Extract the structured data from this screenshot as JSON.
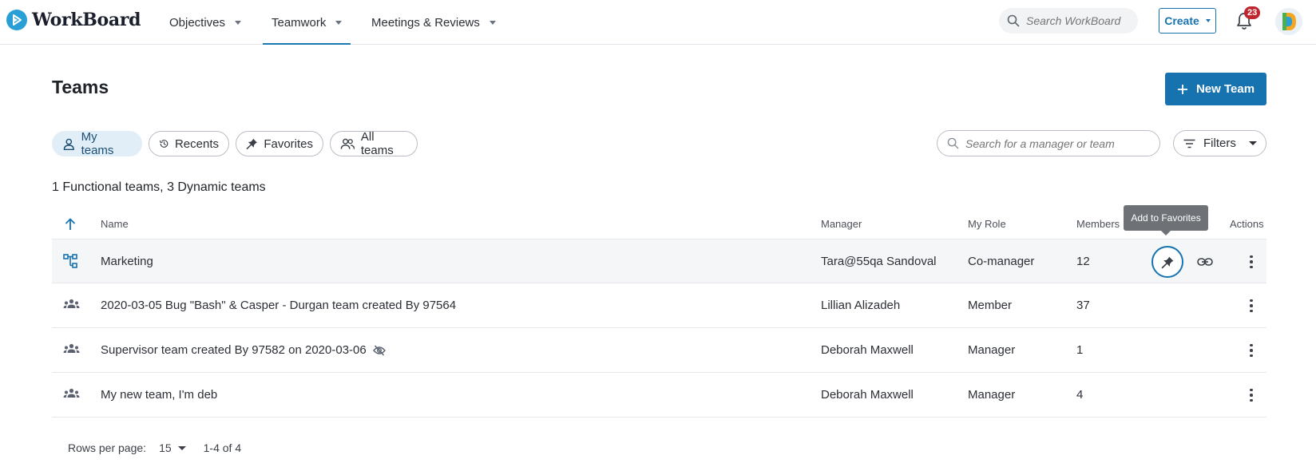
{
  "app": {
    "name": "WorkBoard"
  },
  "nav": {
    "items": [
      {
        "label": "Objectives",
        "active": false
      },
      {
        "label": "Teamwork",
        "active": true
      },
      {
        "label": "Meetings & Reviews",
        "active": false
      }
    ],
    "search_placeholder": "Search WorkBoard",
    "create_label": "Create",
    "notifications_count": "23",
    "accent_color": "#1673b0"
  },
  "page": {
    "title": "Teams",
    "new_team_label": "New Team"
  },
  "filters": {
    "chips": [
      {
        "label": "My teams",
        "icon": "person-icon",
        "selected": true
      },
      {
        "label": "Recents",
        "icon": "history-icon",
        "selected": false
      },
      {
        "label": "Favorites",
        "icon": "pin-icon",
        "selected": false
      },
      {
        "label": "All teams",
        "icon": "people-icon",
        "selected": false
      }
    ],
    "search_placeholder": "Search for a manager or team",
    "filters_label": "Filters"
  },
  "summary": "1 Functional teams, 3 Dynamic teams",
  "table": {
    "columns": {
      "name": "Name",
      "manager": "Manager",
      "role": "My Role",
      "members": "Members",
      "actions": "Actions"
    },
    "sort": "ascending",
    "rows": [
      {
        "type": "functional",
        "name": "Marketing",
        "manager": "Tara@55qa Sandoval",
        "role": "Co-manager",
        "members": "12",
        "hidden": false
      },
      {
        "type": "dynamic",
        "name": "2020-03-05 Bug \"Bash\" & Casper - Durgan team created By 97564",
        "manager": "Lillian Alizadeh",
        "role": "Member",
        "members": "37",
        "hidden": false
      },
      {
        "type": "dynamic",
        "name": "Supervisor team created By 97582 on 2020-03-06",
        "manager": "Deborah Maxwell",
        "role": "Manager",
        "members": "1",
        "hidden": true
      },
      {
        "type": "dynamic",
        "name": "My new team, I'm deb",
        "manager": "Deborah Maxwell",
        "role": "Manager",
        "members": "4",
        "hidden": false
      }
    ]
  },
  "tooltip": "Add to Favorites",
  "pagination": {
    "rows_per_page_label": "Rows per page:",
    "rows_per_page_value": "15",
    "range": "1-4 of 4"
  }
}
